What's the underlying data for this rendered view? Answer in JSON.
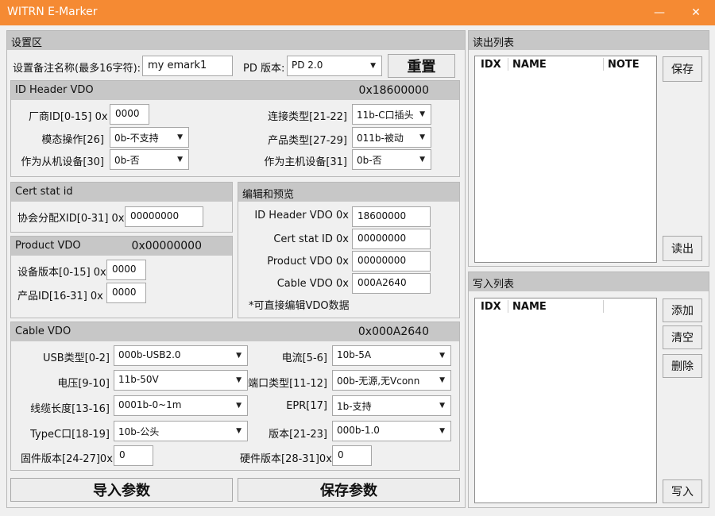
{
  "window": {
    "title": "WITRN E-Marker",
    "minimize": "—",
    "close": "✕"
  },
  "settings": {
    "title": "设置区",
    "note_label": "设置备注名称(最多16字符):",
    "note_value": "my emark1",
    "pd_label": "PD 版本:",
    "pd_value": "PD 2.0",
    "reset_label": "重置"
  },
  "id_header": {
    "title": "ID Header VDO",
    "value": "0x18600000",
    "vendor_label": "厂商ID[0-15] 0x",
    "vendor_value": "0000",
    "conn_label": "连接类型[21-22]",
    "conn_value": "11b-C口插头",
    "modal_label": "模态操作[26]",
    "modal_value": "0b-不支持",
    "product_type_label": "产品类型[27-29]",
    "product_type_value": "011b-被动",
    "ufp_label": "作为从机设备[30]",
    "ufp_value": "0b-否",
    "dfp_label": "作为主机设备[31]",
    "dfp_value": "0b-否"
  },
  "cert": {
    "title": "Cert stat id",
    "xid_label": "协会分配XID[0-31] 0x",
    "xid_value": "00000000"
  },
  "product": {
    "title": "Product VDO",
    "value": "0x00000000",
    "bcd_label": "设备版本[0-15] 0x",
    "bcd_value": "0000",
    "pid_label": "产品ID[16-31]  0x",
    "pid_value": "0000"
  },
  "edit": {
    "title": "编辑和预览",
    "id_header_label": "ID Header VDO 0x",
    "id_header_value": "18600000",
    "cert_label": "Cert stat ID 0x",
    "cert_value": "00000000",
    "product_label": "Product VDO 0x",
    "product_value": "00000000",
    "cable_label": "Cable VDO 0x",
    "cable_value": "000A2640",
    "note": "*可直接编辑VDO数据"
  },
  "cable": {
    "title": "Cable VDO",
    "value": "0x000A2640",
    "usb_label": "USB类型[0-2]",
    "usb_value": "000b-USB2.0",
    "current_label": "电流[5-6]",
    "current_value": "10b-5A",
    "voltage_label": "电压[9-10]",
    "voltage_value": "11b-50V",
    "port_label": "端口类型[11-12]",
    "port_value": "00b-无源,无Vconn",
    "length_label": "线缆长度[13-16]",
    "length_value": "0001b-0~1m",
    "epr_label": "EPR[17]",
    "epr_value": "1b-支持",
    "typec_label": "TypeC口[18-19]",
    "typec_value": "10b-公头",
    "version_label": "版本[21-23]",
    "version_value": "000b-1.0",
    "fw_label": "固件版本[24-27]0x",
    "fw_value": "0",
    "hw_label": "硬件版本[28-31]0x",
    "hw_value": "0"
  },
  "actions": {
    "import_label": "导入参数",
    "save_label": "保存参数"
  },
  "read_list": {
    "title": "读出列表",
    "columns": [
      "IDX",
      "NAME",
      "NOTE"
    ],
    "save_label": "保存",
    "read_label": "读出"
  },
  "write_list": {
    "title": "写入列表",
    "columns": [
      "IDX",
      "NAME"
    ],
    "add_label": "添加",
    "clear_label": "清空",
    "delete_label": "删除",
    "write_label": "写入"
  }
}
